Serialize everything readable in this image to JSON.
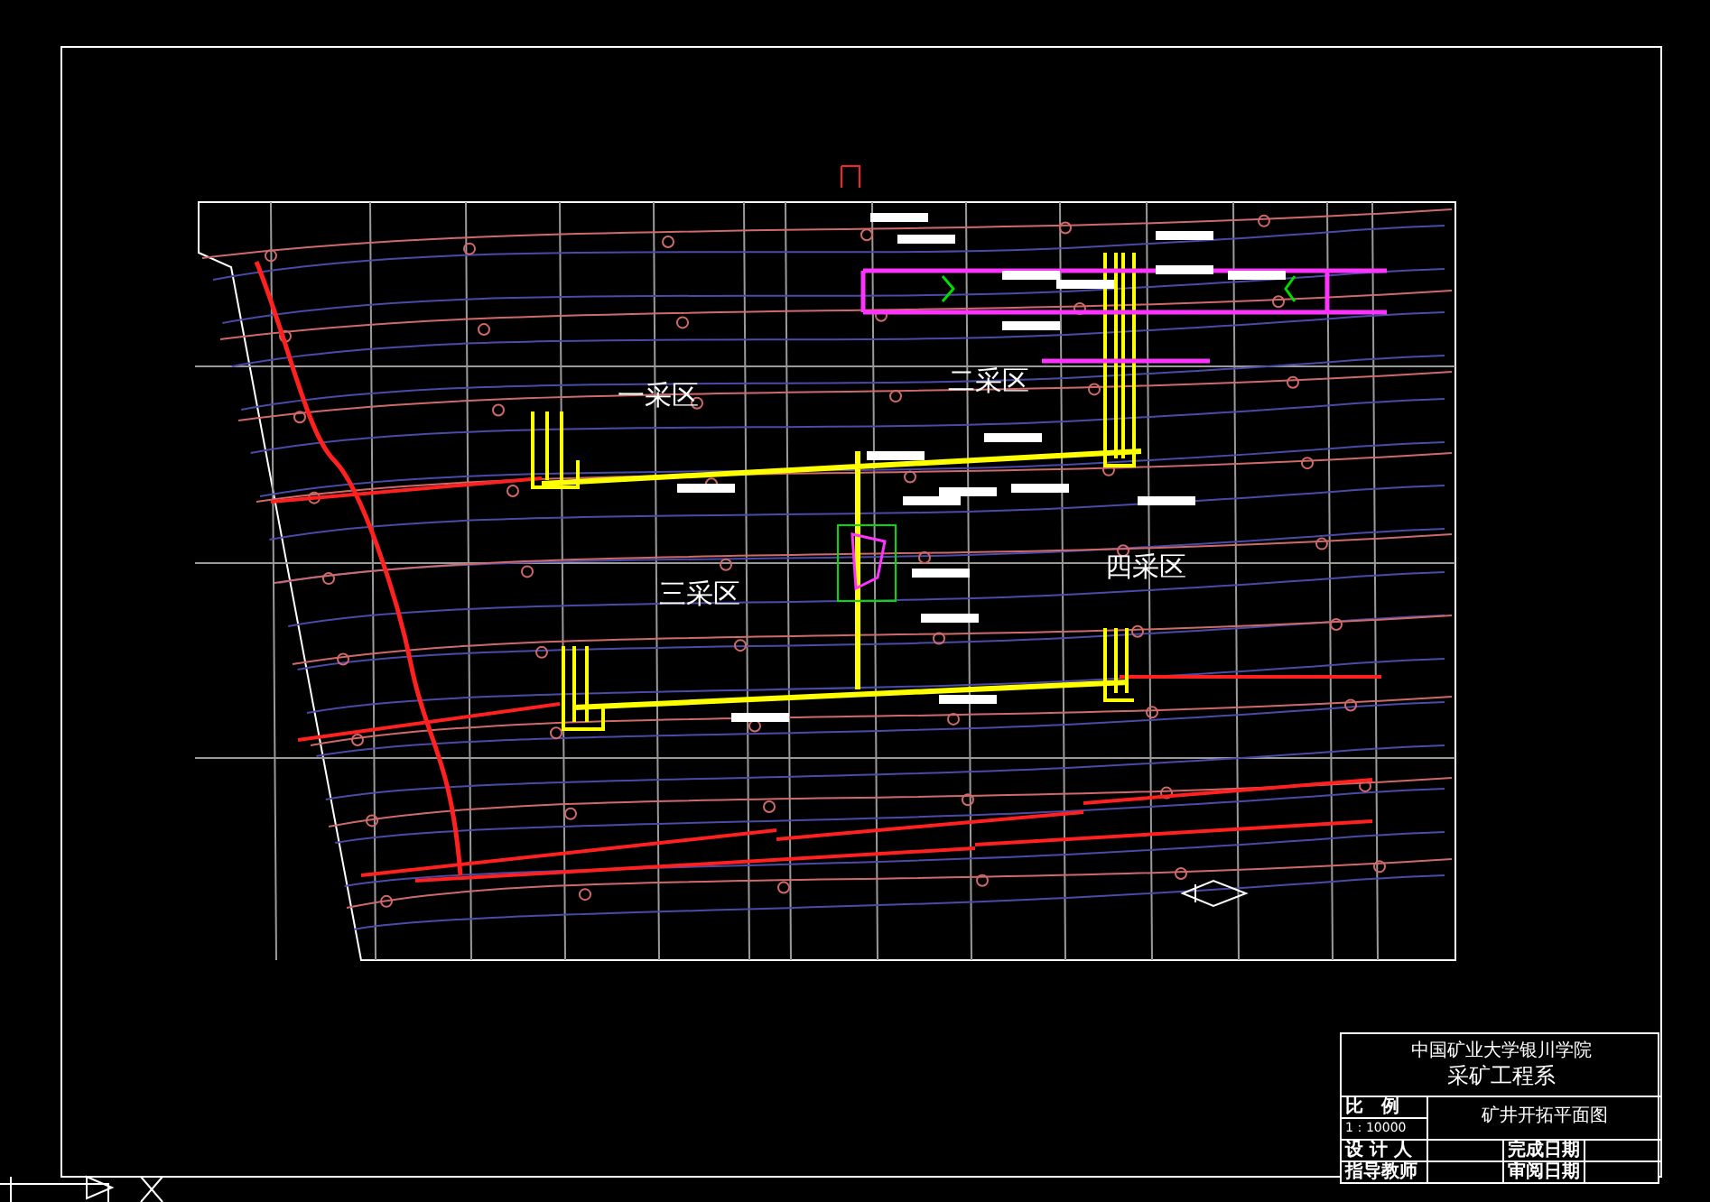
{
  "drawing": {
    "areas": [
      {
        "label": "一采区"
      },
      {
        "label": "二采区"
      },
      {
        "label": "三采区"
      },
      {
        "label": "四采区"
      }
    ]
  },
  "title_block": {
    "institution": "中国矿业大学银川学院",
    "department": "采矿工程系",
    "scale_label": "比　例",
    "scale": "1：10000",
    "drawing_title": "矿井开拓平面图",
    "rows": [
      {
        "label": "设 计 人",
        "date_label": "完成日期"
      },
      {
        "label": "指导教师",
        "date_label": "审阅日期"
      }
    ]
  }
}
